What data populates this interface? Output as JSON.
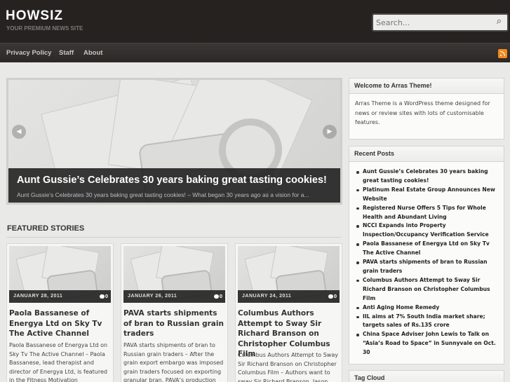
{
  "site": {
    "title": "HOWSIZ",
    "tagline": "YOUR PREMIUM NEWS SITE"
  },
  "search": {
    "placeholder": "Search..."
  },
  "nav": {
    "items": [
      "Privacy Policy",
      "Staff",
      "About"
    ],
    "rss_icon": "rss-icon"
  },
  "slider": {
    "title": "Aunt Gussie’s Celebrates 30 years baking great tasting cookies!",
    "excerpt": "Aunt Gussie’s Celebrates 30 years baking great tasting cookies! – What began 30 years ago as a vision for a...",
    "prev_icon": "chevron-left-icon",
    "next_icon": "chevron-right-icon"
  },
  "featured": {
    "heading": "FEATURED STORIES",
    "stories": [
      {
        "date": "JANUARY 28, 2011",
        "comments": "0",
        "title": "Paola Bassanese of Energya Ltd on Sky Tv The Active Channel",
        "excerpt": "Paola Bassanese of Energya Ltd on Sky Tv The Active Channel – Paola Bassanese, lead therapist and director of Energya Ltd, is featured in the Fitness Motivation"
      },
      {
        "date": "JANUARY 26, 2011",
        "comments": "0",
        "title": "PAVA starts shipments of bran to Russian grain traders",
        "excerpt": "PAVA starts shipments of bran to Russian grain traders – After the grain export embargo was imposed grain traders focused on exporting granular bran. PAVA’s production"
      },
      {
        "date": "JANUARY 24, 2011",
        "comments": "0",
        "title": "Columbus Authors Attempt to Sway Sir Richard Branson on Christopher Columbus Film",
        "excerpt": "Columbus Authors Attempt to Sway Sir Richard Branson on Christopher Columbus Film – Authors want to sway Sir Richard Branson, Jason"
      }
    ]
  },
  "sidebar": {
    "welcome": {
      "title": "Welcome to Arras Theme!",
      "text": "Arras Theme is a WordPress theme designed for news or review sites with lots of customisable features."
    },
    "recent": {
      "title": "Recent Posts",
      "posts": [
        "Aunt Gussie’s Celebrates 30 years baking great tasting cookies!",
        "Platinum Real Estate Group Announces New Website",
        "Registered Nurse Offers 5 Tips for Whole Health and Abundant Living",
        "NCCI Expands into Property Inspection/Occupancy Verification Service",
        "Paola Bassanese of Energya Ltd on Sky Tv The Active Channel",
        "PAVA starts shipments of bran to Russian grain traders",
        "Columbus Authors Attempt to Sway Sir Richard Branson on Christopher Columbus Film",
        "Anti Aging Home Remedy",
        "IIL aims at 7% South India market share; targets sales of Rs.135 crore",
        "China Space Adviser John Lewis to Talk on “Asia’s Road to Space” in Sunnyvale on Oct. 30"
      ]
    },
    "tagcloud": {
      "title": "Tag Cloud"
    }
  }
}
